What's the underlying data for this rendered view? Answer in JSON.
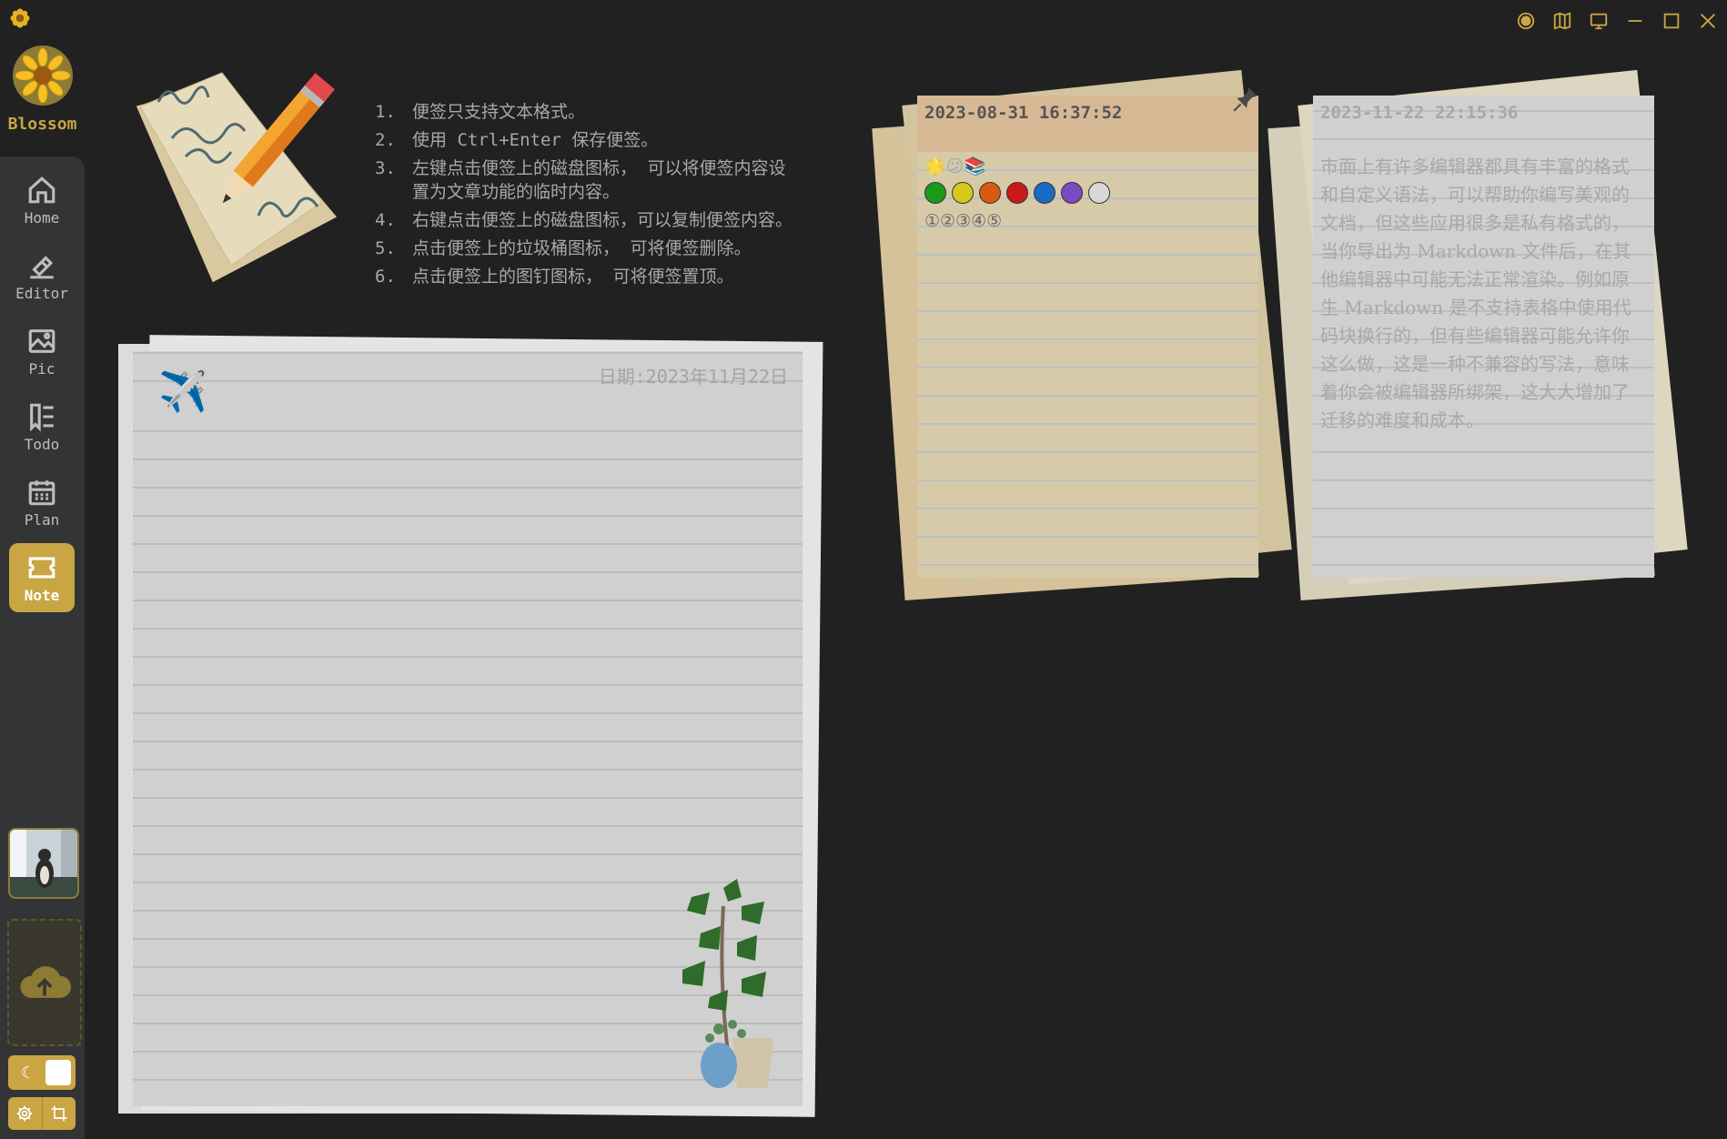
{
  "app": {
    "name": "Blossom"
  },
  "window_controls": [
    {
      "name": "record-icon"
    },
    {
      "name": "columns-icon"
    },
    {
      "name": "monitor-icon"
    },
    {
      "name": "minimize-icon"
    },
    {
      "name": "maximize-icon"
    },
    {
      "name": "close-icon"
    }
  ],
  "sidebar": {
    "items": [
      {
        "label": "Home",
        "icon": "home-icon"
      },
      {
        "label": "Editor",
        "icon": "editor-icon"
      },
      {
        "label": "Pic",
        "icon": "image-icon"
      },
      {
        "label": "Todo",
        "icon": "todo-icon"
      },
      {
        "label": "Plan",
        "icon": "calendar-icon"
      },
      {
        "label": "Note",
        "icon": "ticket-icon",
        "active": true
      }
    ],
    "theme_toggle": {
      "icon": "moon-icon"
    },
    "bottom": [
      {
        "icon": "gear-icon"
      },
      {
        "icon": "crop-icon"
      }
    ]
  },
  "instructions": [
    {
      "n": "1.",
      "text": "便签只支持文本格式。"
    },
    {
      "n": "2.",
      "text": "使用 Ctrl+Enter 保存便签。"
    },
    {
      "n": "3.",
      "text": "左键点击便签上的磁盘图标， 可以将便签内容设置为文章功能的临时内容。"
    },
    {
      "n": "4.",
      "text": "右键点击便签上的磁盘图标，可以复制便签内容。"
    },
    {
      "n": "5.",
      "text": "点击便签上的垃圾桶图标， 可将便签删除。"
    },
    {
      "n": "6.",
      "text": "点击便签上的图钉图标， 可将便签置顶。"
    }
  ],
  "big_note": {
    "date": "日期:2023年11月22日"
  },
  "notes": [
    {
      "timestamp": "2023-08-31 16:37:52",
      "emojis": "🌟😕📚",
      "circles": [
        "#1a9a1a",
        "#d8c81a",
        "#d85a10",
        "#c81a1a",
        "#1a6ac8",
        "#7a4ac0",
        "#d8d8d8"
      ],
      "numbers": "①②③④⑤",
      "pinned": true
    },
    {
      "timestamp": "2023-11-22 22:15:36",
      "text": "市面上有许多编辑器都具有丰富的格式和自定义语法，可以帮助你编写美观的文档，但这些应用很多是私有格式的，当你导出为 Markdown 文件后，在其他编辑器中可能无法正常渲染。例如原生 Markdown 是不支持表格中使用代码块换行的，但有些编辑器可能允许你这么做，这是一种不兼容的写法，意味着你会被编辑器所绑架，这大大增加了迁移的难度和成本。"
    }
  ]
}
